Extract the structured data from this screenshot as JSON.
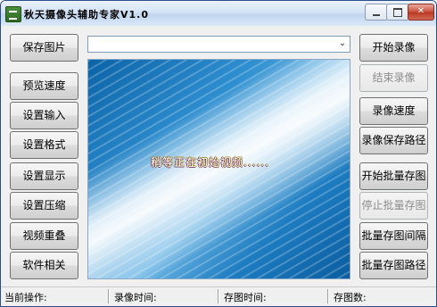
{
  "window": {
    "title": "秋天摄像头辅助专家V1.0",
    "controls": {
      "minimize": "",
      "maximize": "",
      "close": "✕"
    }
  },
  "left_buttons": [
    {
      "label": "保存图片"
    },
    {
      "label": "预览速度"
    },
    {
      "label": "设置输入"
    },
    {
      "label": "设置格式"
    },
    {
      "label": "设置显示"
    },
    {
      "label": "设置压缩"
    },
    {
      "label": "视频重叠"
    },
    {
      "label": "软件相关"
    }
  ],
  "right_buttons": [
    {
      "label": "开始录像",
      "enabled": true
    },
    {
      "label": "结束录像",
      "enabled": false
    },
    {
      "label": "录像速度",
      "enabled": true
    },
    {
      "label": "录像保存路径",
      "enabled": true
    },
    {
      "label": "开始批量存图",
      "enabled": true
    },
    {
      "label": "停止批量存图",
      "enabled": false
    },
    {
      "label": "批量存图间隔",
      "enabled": true
    },
    {
      "label": "批量存图路径",
      "enabled": true
    }
  ],
  "device_select": {
    "value": ""
  },
  "preview": {
    "message": "稍等正在初始视频......"
  },
  "statusbar": {
    "current_op": "当前操作:",
    "record_time": "录像时间:",
    "capture_time": "存图时间:",
    "capture_count": "存图数:"
  },
  "colors": {
    "title_gradient": "#d4e4f6",
    "preview_blue": "#2e8fd0",
    "close_red": "#c9503d",
    "disabled_text": "#8d8d8d"
  }
}
